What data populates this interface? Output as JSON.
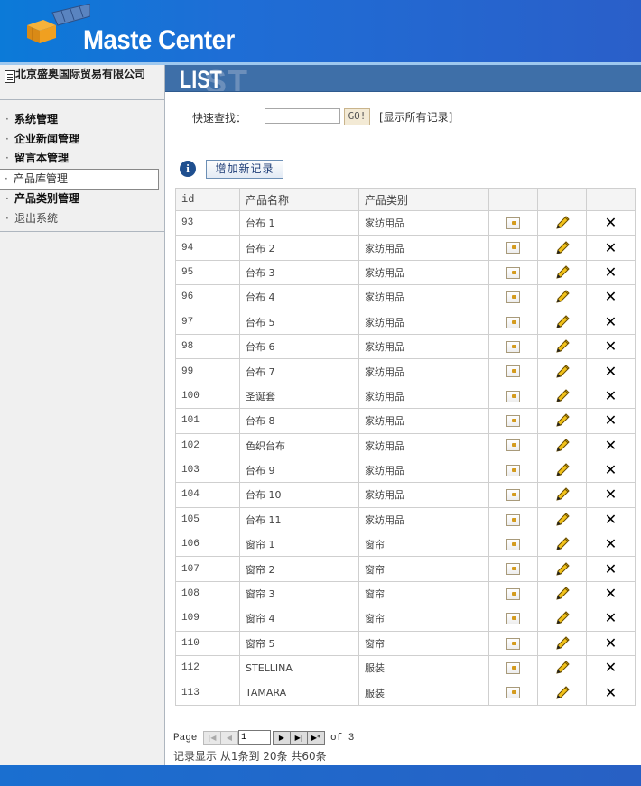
{
  "header": {
    "title": "Maste Center"
  },
  "sidebar": {
    "company": "北京盛奥国际贸易有限公司",
    "items": [
      {
        "label": "系统管理"
      },
      {
        "label": "企业新闻管理"
      },
      {
        "label": "留言本管理"
      },
      {
        "label": "产品库管理"
      },
      {
        "label": "产品类别管理"
      },
      {
        "label": "退出系统"
      }
    ]
  },
  "banner": {
    "title": "LIST",
    "ghost": "ST"
  },
  "search": {
    "label": "快速查找：",
    "value": "",
    "go_label": "GO!",
    "show_all_label": "[显示所有记录]"
  },
  "actions": {
    "add_label": "增加新记录"
  },
  "table": {
    "columns": [
      "id",
      "产品名称",
      "产品类别",
      "",
      "",
      ""
    ],
    "rows": [
      {
        "id": "93",
        "name": "台布 1",
        "category": "家纺用品"
      },
      {
        "id": "94",
        "name": "台布 2",
        "category": "家纺用品"
      },
      {
        "id": "95",
        "name": "台布 3",
        "category": "家纺用品"
      },
      {
        "id": "96",
        "name": "台布 4",
        "category": "家纺用品"
      },
      {
        "id": "97",
        "name": "台布 5",
        "category": "家纺用品"
      },
      {
        "id": "98",
        "name": "台布 6",
        "category": "家纺用品"
      },
      {
        "id": "99",
        "name": "台布 7",
        "category": "家纺用品"
      },
      {
        "id": "100",
        "name": "圣诞套",
        "category": "家纺用品"
      },
      {
        "id": "101",
        "name": "台布 8",
        "category": "家纺用品"
      },
      {
        "id": "102",
        "name": "色织台布",
        "category": "家纺用品"
      },
      {
        "id": "103",
        "name": "台布 9",
        "category": "家纺用品"
      },
      {
        "id": "104",
        "name": "台布 10",
        "category": "家纺用品"
      },
      {
        "id": "105",
        "name": "台布 11",
        "category": "家纺用品"
      },
      {
        "id": "106",
        "name": "窗帘 1",
        "category": "窗帘"
      },
      {
        "id": "107",
        "name": "窗帘 2",
        "category": "窗帘"
      },
      {
        "id": "108",
        "name": "窗帘 3",
        "category": "窗帘"
      },
      {
        "id": "109",
        "name": "窗帘 4",
        "category": "窗帘"
      },
      {
        "id": "110",
        "name": "窗帘 5",
        "category": "窗帘"
      },
      {
        "id": "112",
        "name": "STELLINA",
        "category": "服装"
      },
      {
        "id": "113",
        "name": "TAMARA",
        "category": "服装"
      }
    ],
    "row_icons": [
      "view-icon",
      "edit-pencil-icon",
      "delete-x-icon"
    ]
  },
  "pager": {
    "page_label": "Page",
    "current_page": "1",
    "of_text": "of 3",
    "status": "记录显示  从1条到 20条  共60条"
  }
}
